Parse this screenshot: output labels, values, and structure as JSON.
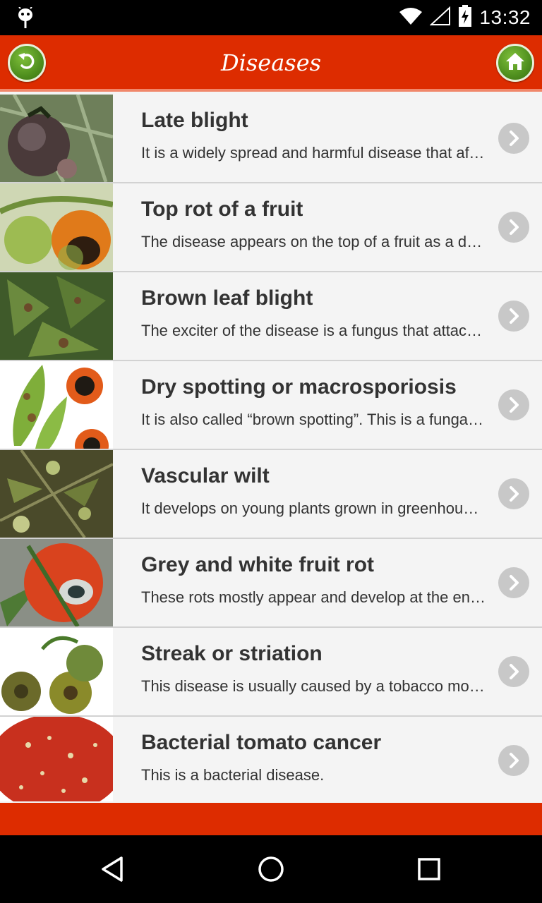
{
  "status_bar": {
    "time": "13:32",
    "icons": [
      "android-icon",
      "wifi-icon",
      "signal-icon",
      "battery-charging-icon"
    ]
  },
  "app_bar": {
    "title": "Diseases",
    "back_icon": "undo-arrow-icon",
    "home_icon": "home-icon",
    "accent_color": "#dd2c00",
    "button_color": "#5a9a22"
  },
  "diseases": [
    {
      "name": "Late blight",
      "description": "It is a widely spread and harmful disease that affects tomatoes.",
      "thumb_icon": "tomato-late-blight-photo"
    },
    {
      "name": "Top rot of a fruit",
      "description": "The disease appears on the top of a fruit as a dark spot.",
      "thumb_icon": "tomato-top-rot-photo"
    },
    {
      "name": "Brown leaf blight",
      "description": "The exciter of the disease is a fungus that attacks the leaves.",
      "thumb_icon": "brown-leaf-blight-photo"
    },
    {
      "name": "Dry spotting or macrosporiosis",
      "description": "It is also called “brown spotting”. This is a fungal disease.",
      "thumb_icon": "dry-spotting-illustration"
    },
    {
      "name": "Vascular wilt",
      "description": "It develops on young plants grown in greenhouses.",
      "thumb_icon": "vascular-wilt-photo"
    },
    {
      "name": "Grey and white fruit rot",
      "description": "These rots mostly appear and develop at the end of the season.",
      "thumb_icon": "grey-white-fruit-rot-photo"
    },
    {
      "name": "Streak or striation",
      "description": "This disease is usually caused by a tobacco mosaic virus.",
      "thumb_icon": "streak-striation-photo"
    },
    {
      "name": "Bacterial tomato cancer",
      "description": "This is a bacterial disease.",
      "thumb_icon": "bacterial-cancer-photo"
    }
  ],
  "row_chevron_icon": "chevron-right-circle-icon",
  "nav_bar": {
    "icons": [
      "back-triangle-icon",
      "home-circle-icon",
      "recents-square-icon"
    ]
  }
}
